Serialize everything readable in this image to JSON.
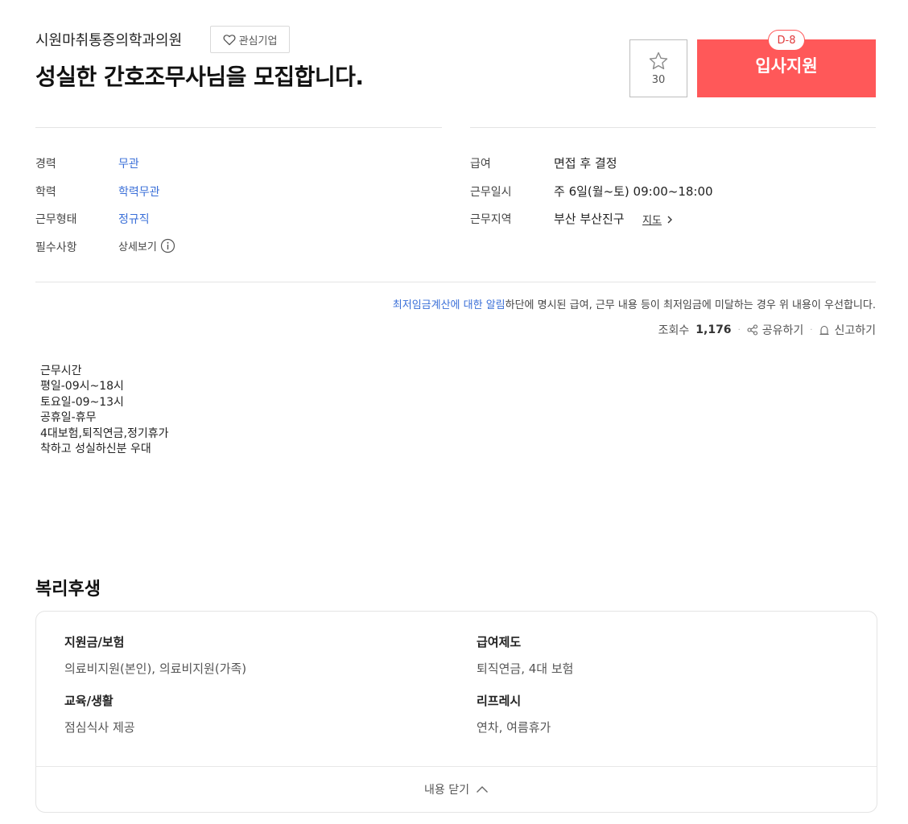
{
  "header": {
    "company_name": "시원마취통증의학과의원",
    "favorite_company_label": "관심기업",
    "job_title": "성실한 간호조무사님을 모집합니다.",
    "scrap_count": "30",
    "dday": "D-8",
    "apply_label": "입사지원"
  },
  "conditions_left": [
    {
      "label": "경력",
      "value": "무관"
    },
    {
      "label": "학력",
      "value": "학력무관"
    },
    {
      "label": "근무형태",
      "value": "정규직"
    },
    {
      "label": "필수사항",
      "value": "상세보기"
    }
  ],
  "conditions_right": [
    {
      "label": "급여",
      "value": "면접 후 결정"
    },
    {
      "label": "근무일시",
      "value": "주 6일(월~토) 09:00~18:00"
    },
    {
      "label": "근무지역",
      "value": "부산 부산진구"
    }
  ],
  "map_link_label": "지도",
  "notice": {
    "link_text": "최저임금계산에 대한 알림",
    "text": "하단에 명시된 급여, 근무 내용 등이 최저임금에 미달하는 경우 위 내용이 우선합니다."
  },
  "stats": {
    "views_label": "조회수",
    "views_count": "1,176",
    "share_label": "공유하기",
    "report_label": "신고하기"
  },
  "description_lines": [
    "근무시간",
    "평일-09시~18시",
    "토요일-09~13시",
    "공휴일-휴무",
    "4대보험,퇴직연금,정기휴가",
    "착하고 성실하신분 우대"
  ],
  "welfare": {
    "title": "복리후생",
    "groups": [
      {
        "category": "지원금/보험",
        "items": "의료비지원(본인), 의료비지원(가족)"
      },
      {
        "category": "급여제도",
        "items": "퇴직연금, 4대 보험"
      },
      {
        "category": "교육/생활",
        "items": "점심식사 제공"
      },
      {
        "category": "리프레시",
        "items": "연차, 여름휴가"
      }
    ],
    "close_label": "내용 닫기"
  },
  "colors": {
    "accent": "#ff5859",
    "link_blue": "#3a6fd8"
  }
}
